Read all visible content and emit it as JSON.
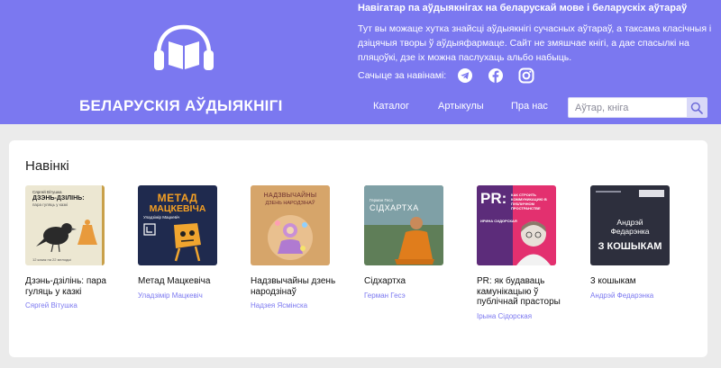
{
  "header": {
    "site_title": "БЕЛАРУСКІЯ АЎДЫЯКНІГІ",
    "tagline": "Навігатар па аўдыякнігах на беларускай мове і беларускіх аўтараў",
    "intro": "Тут вы можаце хутка знайсці аўдыякнігі сучасных аўтараў, а таксама класічныя і дзіцячыя творы ў аўдыяфармаце. Сайт не змяшчае кнігі, а дае спасылкі на пляцоўкі, дзе іх можна паслухаць альбо набыць.",
    "follow_label": "Сачыце за навінамі:",
    "social_icons": [
      "telegram-icon",
      "facebook-icon",
      "instagram-icon"
    ],
    "nav": {
      "catalog": "Каталог",
      "articles": "Артыкулы",
      "about": "Пра нас"
    },
    "search": {
      "placeholder": "Аўтар, кніга"
    },
    "colors": {
      "accent": "#7b78f0",
      "background": "#ebebeb"
    }
  },
  "main": {
    "section_title": "Навінкі",
    "books": [
      {
        "title": "Дзэнь-дзілінь: пара гуляць у казкі",
        "author": "Сяргей Вітушка",
        "cover": {
          "top_text": "Сяргей Вітушка",
          "title_text": "ДЗЭНЬ-ДЗІЛІНЬ:",
          "sub_text": "пара гуляць у казкі",
          "bottom_text": "12 казак на 22 мелодыі"
        }
      },
      {
        "title": "Метад Мацкевіча",
        "author": "Уладзімір Мацкевіч",
        "cover": {
          "title_line1": "МЕТАД",
          "title_line2": "МАЦКЕВІЧА",
          "author_text": "Уладзімір Мацкевіч"
        }
      },
      {
        "title": "Надзвычайны дзень народзінаў",
        "author": "Надзея Ясмінска",
        "cover": {
          "title_line1": "НАДЗВЫЧАЙНЫ",
          "title_line2": "ДЗЕНЬ НАРОДЗІНАЎ"
        }
      },
      {
        "title": "Сідхартха",
        "author": "Герман Гесэ",
        "cover": {
          "author_text": "Герман Гесэ",
          "title_text": "СІДХАРТХА"
        }
      },
      {
        "title": "PR: як будаваць камунікацыю ў публічнай прасторы",
        "author": "Ірына Сідорская",
        "cover": {
          "pr_text": "PR:",
          "subtitle": "КАК СТРОИТЬ КОММУНИКАЦИЮ В ПУБЛИЧНОМ ПРОСТРАНСТВЕ",
          "author_text": "ИРИНА СИДОРСКАЯ"
        }
      },
      {
        "title": "3 кошыкам",
        "author": "Андрэй Федарэнка",
        "cover": {
          "author_line1": "Андрэй",
          "author_line2": "Федарэнка",
          "title_text": "З КОШЫКАМ"
        }
      }
    ]
  }
}
